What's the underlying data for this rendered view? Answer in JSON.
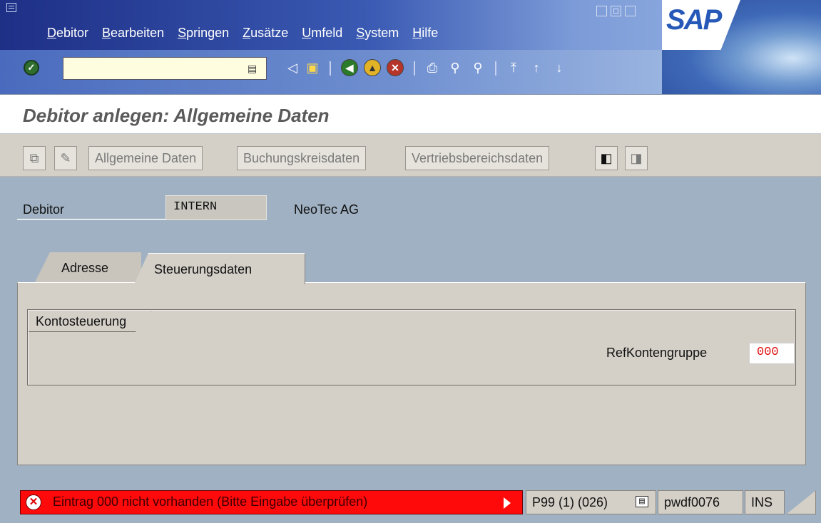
{
  "menu": {
    "items": [
      "Debitor",
      "Bearbeiten",
      "Springen",
      "Zusätze",
      "Umfeld",
      "System",
      "Hilfe"
    ]
  },
  "logo": {
    "text": "SAP"
  },
  "toolbar": {
    "command_field": {
      "value": ""
    }
  },
  "title": "Debitor anlegen: Allgemeine Daten",
  "app_toolbar": {
    "buttons": [
      "Allgemeine Daten",
      "Buchungskreisdaten",
      "Vertriebsbereichsdaten"
    ]
  },
  "customer": {
    "label": "Debitor",
    "value": "INTERN",
    "name": "NeoTec AG"
  },
  "tabs": [
    {
      "label": "Adresse",
      "active": false
    },
    {
      "label": "Steuerungsdaten",
      "active": true
    }
  ],
  "group": {
    "title": "Kontosteuerung",
    "field_label": "RefKontengruppe",
    "field_value": "000"
  },
  "statusbar": {
    "message": "Eintrag 000   nicht vorhanden (Bitte Eingabe überprüfen)",
    "system": "P99 (1) (026)",
    "server": "pwdf0076",
    "mode": "INS",
    "error_color": "#ff0a0a"
  }
}
